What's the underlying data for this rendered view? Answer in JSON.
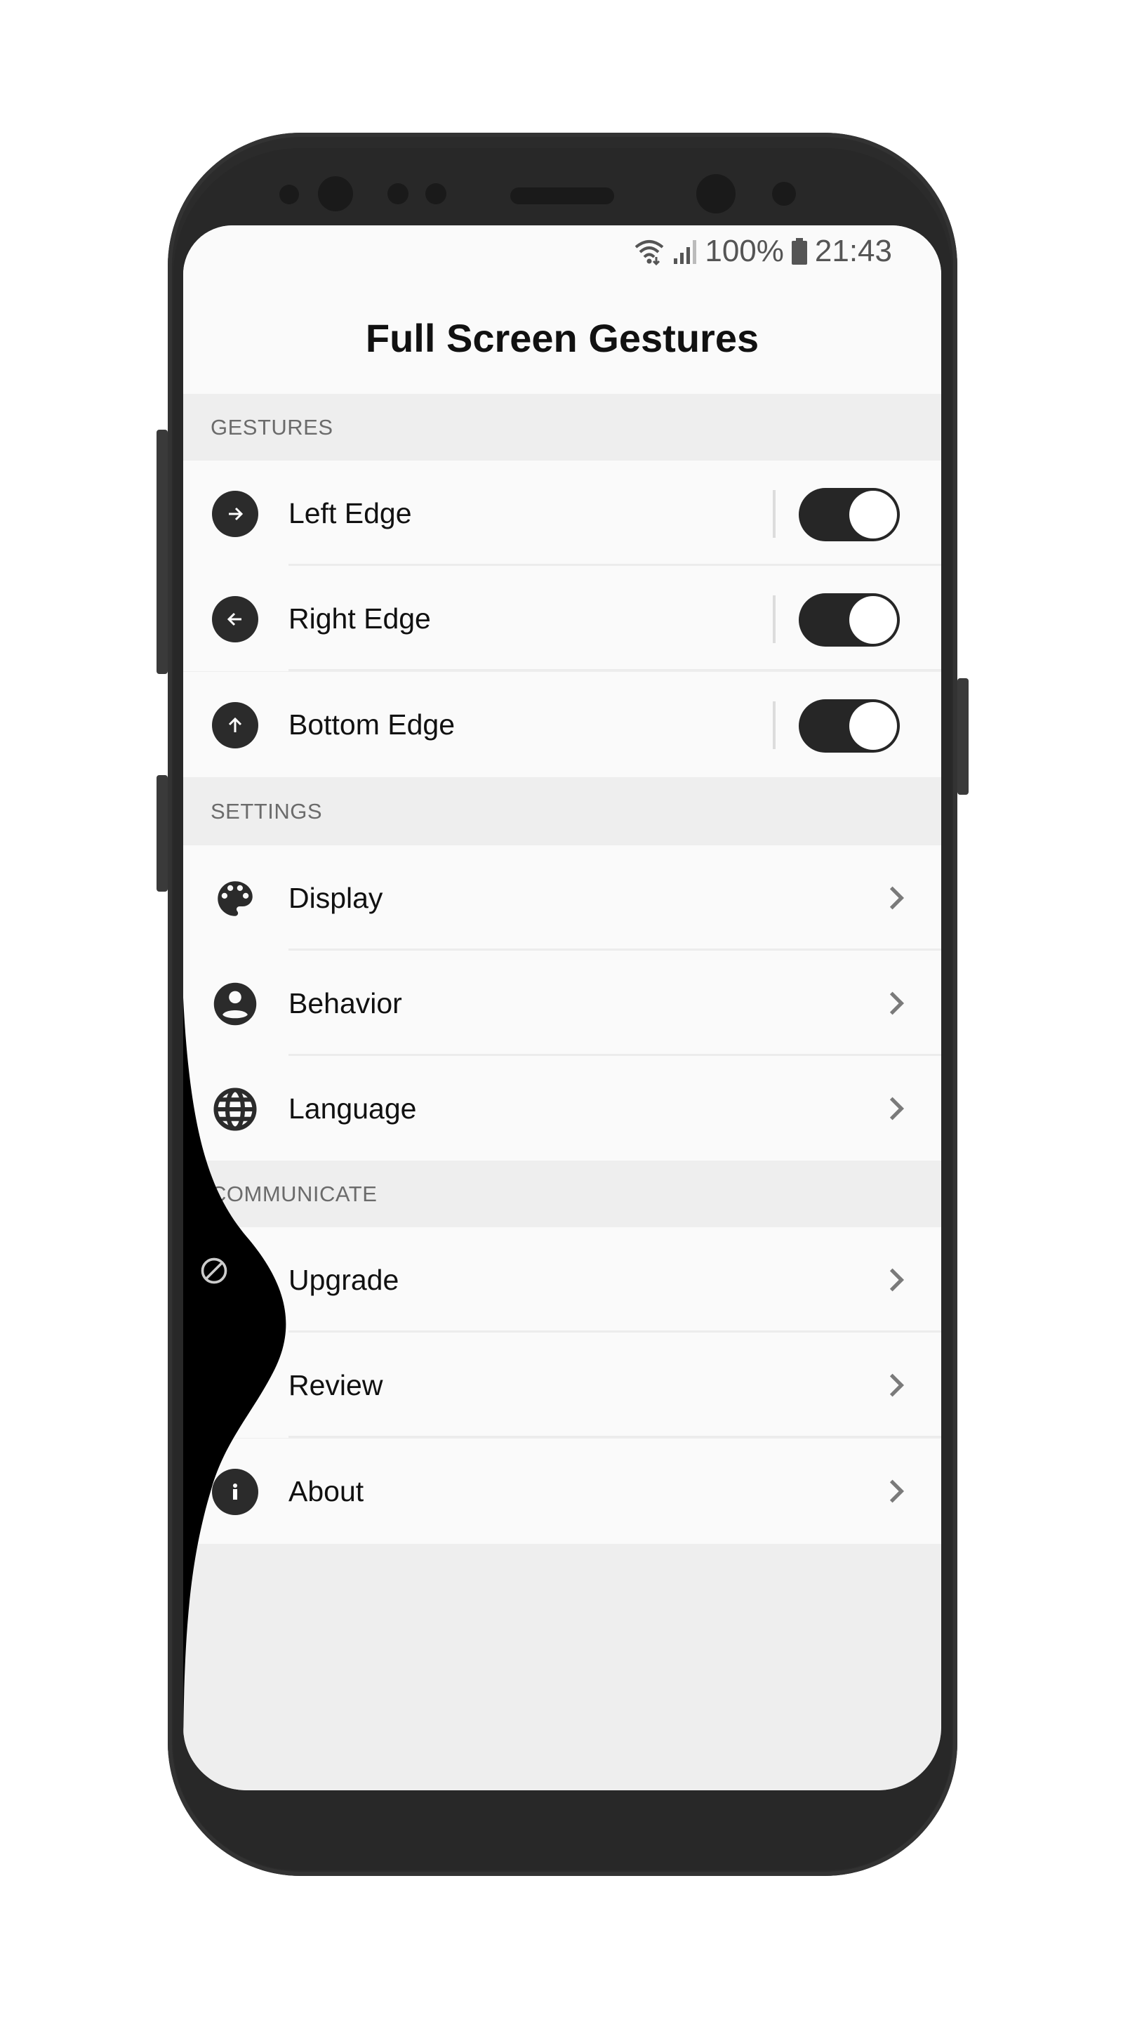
{
  "status_bar": {
    "battery_percent": "100%",
    "time": "21:43",
    "icons": [
      "wifi-icon",
      "signal-icon",
      "battery-icon"
    ]
  },
  "app_bar": {
    "title": "Full Screen Gestures"
  },
  "sections": {
    "gestures": {
      "header": "GESTURES",
      "items": [
        {
          "label": "Left Edge",
          "icon": "arrow-right-icon",
          "enabled": true
        },
        {
          "label": "Right Edge",
          "icon": "arrow-left-icon",
          "enabled": true
        },
        {
          "label": "Bottom Edge",
          "icon": "arrow-up-icon",
          "enabled": true
        }
      ]
    },
    "settings": {
      "header": "SETTINGS",
      "items": [
        {
          "label": "Display",
          "icon": "palette-icon"
        },
        {
          "label": "Behavior",
          "icon": "account-circle-icon"
        },
        {
          "label": "Language",
          "icon": "globe-icon"
        }
      ]
    },
    "communicate": {
      "header": "COMMUNICATE",
      "items": [
        {
          "label": "Upgrade",
          "icon": "upgrade-icon"
        },
        {
          "label": "Review",
          "icon": "review-icon"
        },
        {
          "label": "About",
          "icon": "info-icon"
        }
      ]
    }
  },
  "edge_gesture_overlay": {
    "icon": "block-icon"
  },
  "colors": {
    "accent": "#262626",
    "background": "#fafafa",
    "section_background": "#eeeeee",
    "section_text": "#6b6b6b"
  }
}
